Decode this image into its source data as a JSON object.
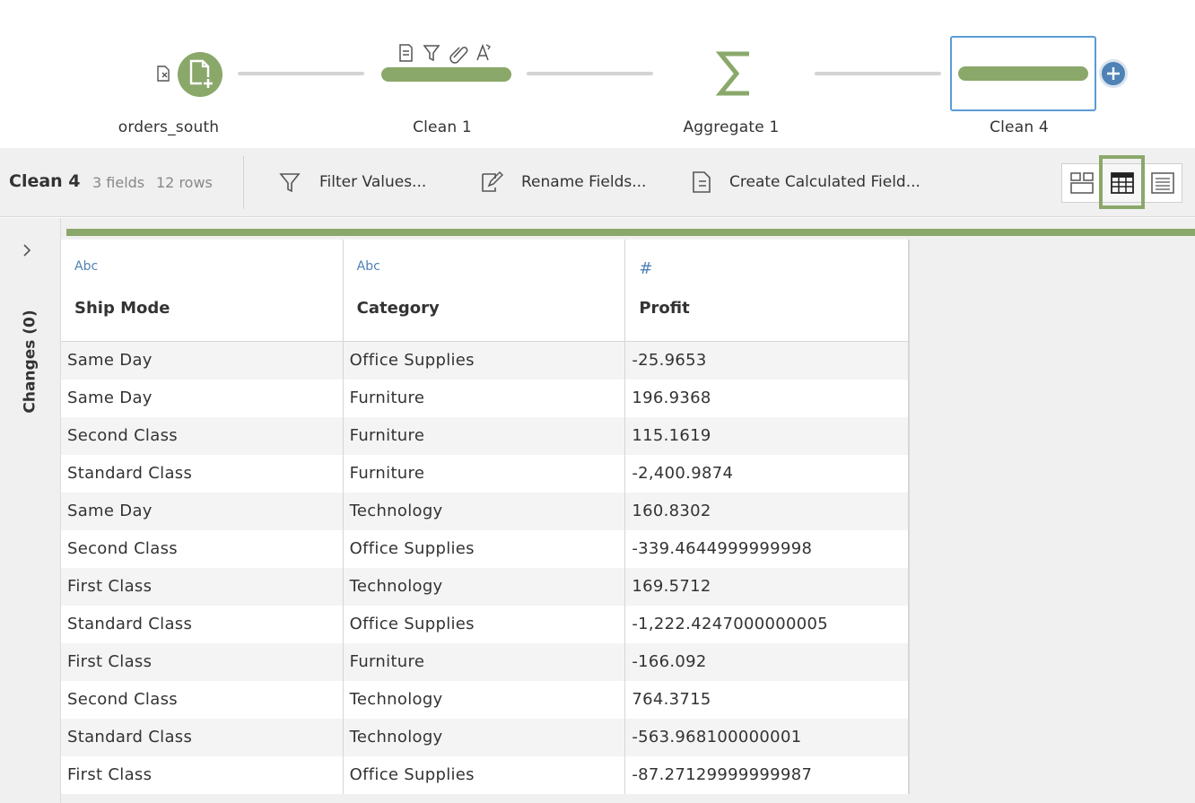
{
  "flow": {
    "nodes": [
      {
        "label": "orders_south",
        "type": "input"
      },
      {
        "label": "Clean 1",
        "type": "clean"
      },
      {
        "label": "Aggregate 1",
        "type": "aggregate"
      },
      {
        "label": "Clean 4",
        "type": "clean",
        "selected": true
      }
    ]
  },
  "toolbar": {
    "step_name": "Clean 4",
    "fields": "3 fields",
    "rows": "12 rows",
    "actions": {
      "filter": "Filter Values...",
      "rename": "Rename Fields...",
      "calculated": "Create Calculated Field..."
    },
    "views": [
      "profile-view",
      "list-view",
      "detail-view"
    ],
    "active_view": "list-view"
  },
  "changes_panel": {
    "label": "Changes (0)"
  },
  "grid": {
    "columns": [
      {
        "type_label": "Abc",
        "name": "Ship Mode"
      },
      {
        "type_label": "Abc",
        "name": "Category"
      },
      {
        "type_label": "#",
        "name": "Profit"
      }
    ],
    "rows": [
      [
        "Same Day",
        "Office Supplies",
        "-25.9653"
      ],
      [
        "Same Day",
        "Furniture",
        "196.9368"
      ],
      [
        "Second Class",
        "Furniture",
        "115.1619"
      ],
      [
        "Standard Class",
        "Furniture",
        "-2,400.9874"
      ],
      [
        "Same Day",
        "Technology",
        "160.8302"
      ],
      [
        "Second Class",
        "Office Supplies",
        "-339.4644999999998"
      ],
      [
        "First Class",
        "Technology",
        "169.5712"
      ],
      [
        "Standard Class",
        "Office Supplies",
        "-1,222.4247000000005"
      ],
      [
        "First Class",
        "Furniture",
        "-166.092"
      ],
      [
        "Second Class",
        "Technology",
        "764.3715"
      ],
      [
        "Standard Class",
        "Technology",
        "-563.968100000001"
      ],
      [
        "First Class",
        "Office Supplies",
        "-87.27129999999987"
      ]
    ]
  },
  "colors": {
    "node_green": "#8aa86a",
    "selection_blue": "#5b9bd5",
    "type_blue": "#4f82b5",
    "panel_gray": "#f0f0f0"
  }
}
